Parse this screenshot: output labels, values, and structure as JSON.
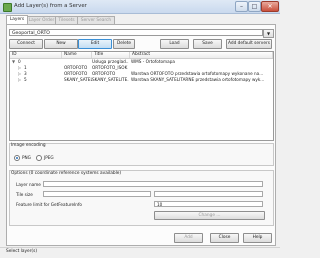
{
  "window": {
    "title": "Add Layer(s) from a Server",
    "minimize": "–",
    "maximize": "□",
    "close": "✕"
  },
  "tabs": [
    "Layers",
    "Layer Order",
    "Tilesets",
    "Server Search"
  ],
  "connection": {
    "selected": "Geoportal_ORTO",
    "arrow": "▼"
  },
  "buttons": {
    "connect": "Connect",
    "new": "New",
    "edit": "Edit",
    "delete": "Delete",
    "load": "Load",
    "save": "Save",
    "add_default": "Add default servers"
  },
  "tree": {
    "columns": [
      "ID",
      "Name",
      "Title",
      "Abstract"
    ],
    "rows": [
      {
        "expander": "▼",
        "id": "0",
        "name": "",
        "title": "Usługa przeglad...",
        "abstract": "WMS - Ortofotomapa"
      },
      {
        "expander": "▷",
        "id": "1",
        "name": "ORTOFOTO",
        "title": "ORTOFOTO_ISOK",
        "abstract": ""
      },
      {
        "expander": "▷",
        "id": "3",
        "name": "ORTOFOTO",
        "title": "ORTOFOTO",
        "abstract": "Warstwa ORTOFOTO przedstawia ortofotomapy wykonane na..."
      },
      {
        "expander": "▷",
        "id": "5",
        "name": "SKANY_SATELITE...",
        "title": "SKANY_SATELITE...",
        "abstract": "Warstwa SKANY_SATELITARNE przedstawia ortofotomapy wyk..."
      }
    ]
  },
  "image_encoding": {
    "title": "Image encoding",
    "options": [
      "PNG",
      "JPEG"
    ],
    "selected": "PNG"
  },
  "options": {
    "title": "Options (0 coordinate reference systems available)",
    "layer_name_label": "Layer name",
    "tile_size_label": "Tile size",
    "feature_limit_label": "Feature limit for GetFeatureInfo",
    "feature_limit_value": "10",
    "change_button": "Change ..."
  },
  "footer": {
    "add": "Add",
    "close": "Close",
    "help": "Help"
  },
  "status": "Select layer(s)"
}
